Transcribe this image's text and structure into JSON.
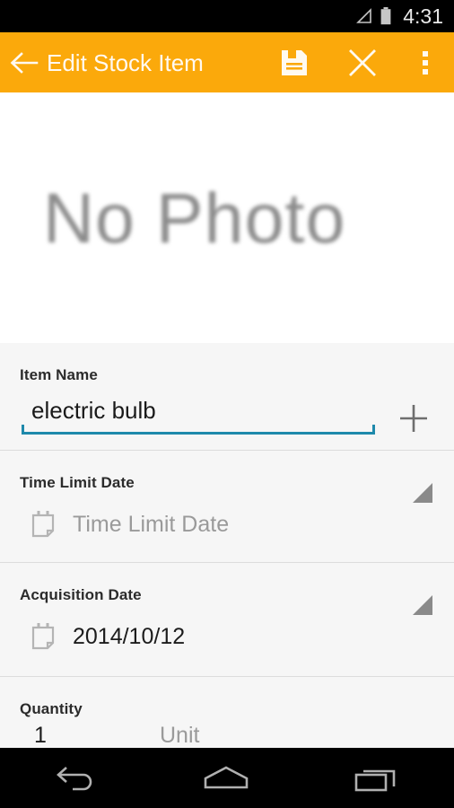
{
  "status_bar": {
    "time": "4:31",
    "signal_icon": "signal-triangle-icon",
    "battery_icon": "battery-full-icon",
    "background": "#000000",
    "text_color": "#e8e8e8"
  },
  "appbar": {
    "title": "Edit Stock Item",
    "background": "#fba90b",
    "title_color": "#fff9f1",
    "back_icon": "back-arrow-icon",
    "actions": [
      {
        "name": "save",
        "icon": "floppy-save-icon"
      },
      {
        "name": "cancel",
        "icon": "close-x-icon"
      },
      {
        "name": "overflow",
        "icon": "overflow-menu-icon"
      }
    ]
  },
  "photo": {
    "placeholder_text": "No Photo",
    "text_color": "#8c8c8c",
    "background": "#ffffff"
  },
  "form": {
    "background": "#f6f6f6",
    "divider_color": "#dcdcdc",
    "accent_underline": "#1e89ab",
    "fields": {
      "item_name": {
        "label": "Item Name",
        "value": "electric bulb",
        "placeholder": "Item Name",
        "add_icon": "plus-icon"
      },
      "time_limit_date": {
        "label": "Time Limit Date",
        "value": "",
        "placeholder": "Time Limit Date",
        "calendar_icon": "calendar-icon",
        "spinner_icon": "spinner-triangle-icon"
      },
      "acquisition_date": {
        "label": "Acquisition Date",
        "value": "2014/10/12",
        "placeholder": "Acquisition Date",
        "calendar_icon": "calendar-icon",
        "spinner_icon": "spinner-triangle-icon"
      },
      "quantity": {
        "label": "Quantity",
        "value": "1",
        "unit_placeholder": "Unit"
      }
    }
  },
  "navbar": {
    "background": "#000000",
    "buttons": [
      {
        "name": "back",
        "icon": "nav-back-icon"
      },
      {
        "name": "home",
        "icon": "nav-home-icon"
      },
      {
        "name": "recents",
        "icon": "nav-recents-icon"
      }
    ]
  }
}
